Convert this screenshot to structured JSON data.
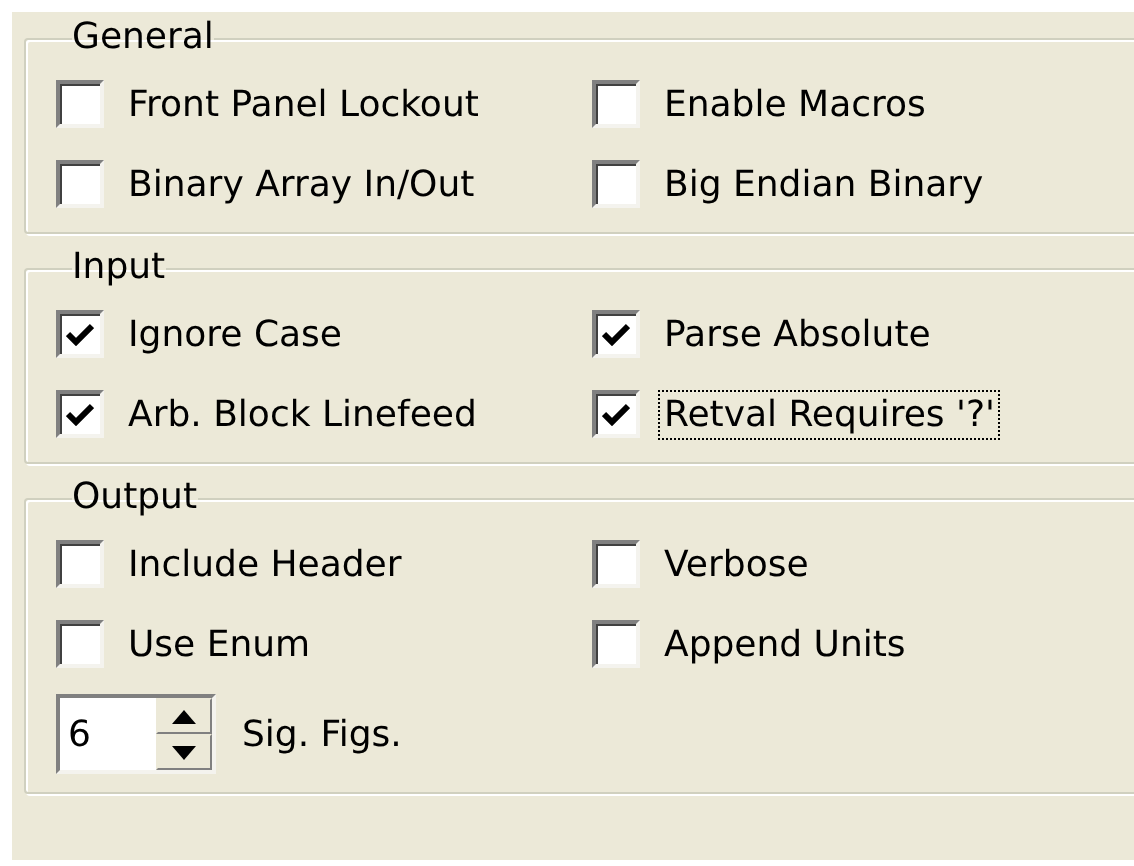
{
  "groups": [
    {
      "title": "General",
      "options": [
        {
          "label": "Front Panel Lockout",
          "checked": false,
          "focused": false
        },
        {
          "label": "Enable Macros",
          "checked": false,
          "focused": false
        },
        {
          "label": "Binary Array In/Out",
          "checked": false,
          "focused": false
        },
        {
          "label": "Big Endian Binary",
          "checked": false,
          "focused": false
        }
      ]
    },
    {
      "title": "Input",
      "options": [
        {
          "label": "Ignore Case",
          "checked": true,
          "focused": false
        },
        {
          "label": "Parse Absolute",
          "checked": true,
          "focused": false
        },
        {
          "label": "Arb. Block Linefeed",
          "checked": true,
          "focused": false
        },
        {
          "label": "Retval Requires '?'",
          "checked": true,
          "focused": true
        }
      ]
    },
    {
      "title": "Output",
      "options": [
        {
          "label": "Include Header",
          "checked": false,
          "focused": false
        },
        {
          "label": "Verbose",
          "checked": false,
          "focused": false
        },
        {
          "label": "Use Enum",
          "checked": false,
          "focused": false
        },
        {
          "label": "Append Units",
          "checked": false,
          "focused": false
        }
      ],
      "spinner": {
        "value": "6",
        "label": "Sig. Figs."
      }
    }
  ]
}
